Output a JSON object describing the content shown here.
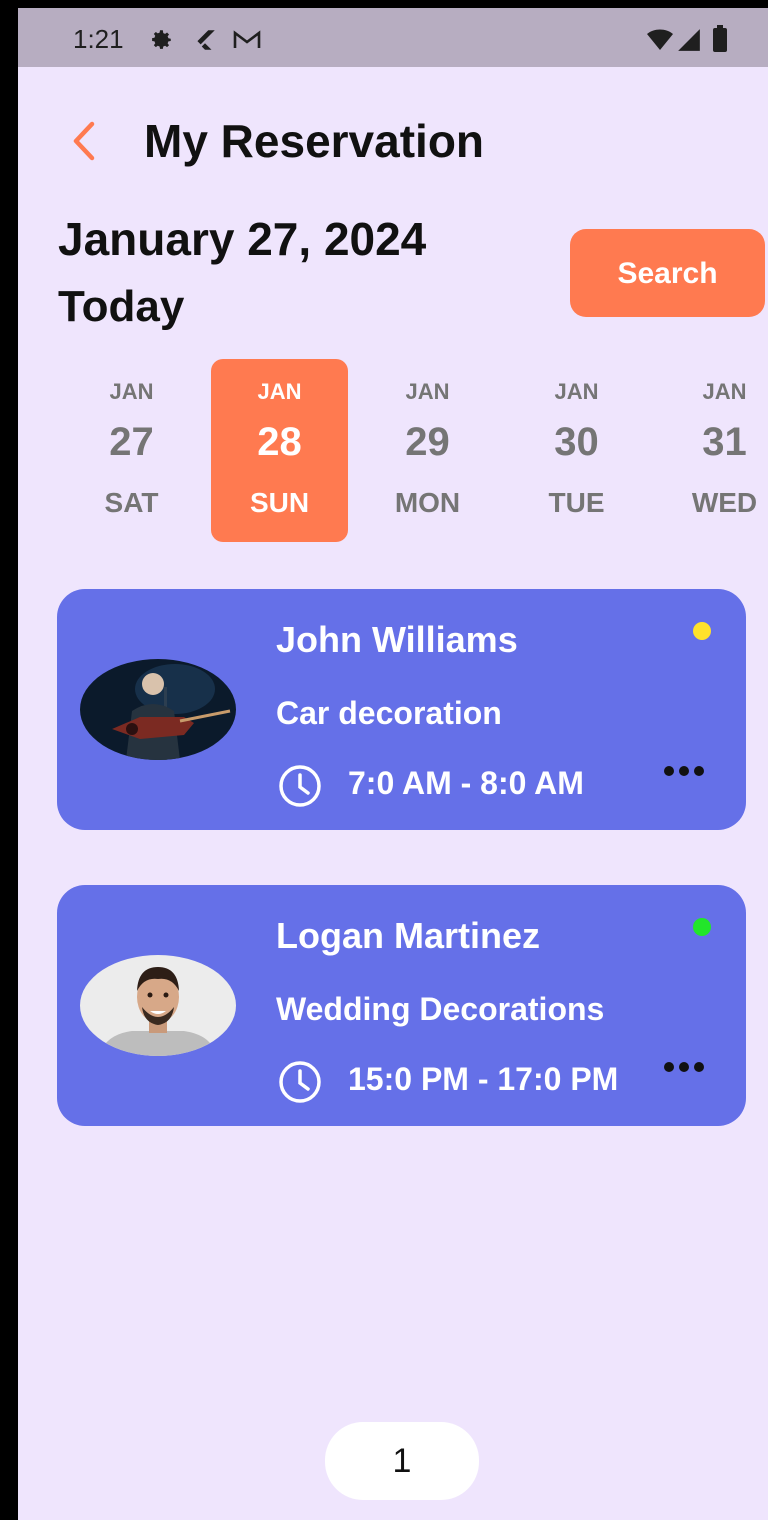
{
  "status_bar": {
    "time": "1:21",
    "icons": [
      "settings-icon",
      "flutter-icon",
      "gmail-icon",
      "wifi-icon",
      "signal-icon",
      "battery-icon"
    ]
  },
  "header": {
    "title": "My Reservation",
    "back_icon": "chevron-left-icon"
  },
  "date": {
    "title": "January 27, 2024",
    "subtitle": "Today"
  },
  "search_button": {
    "label": "Search"
  },
  "calendar": {
    "days": [
      {
        "month": "JAN",
        "day": "27",
        "weekday": "SAT",
        "selected": false
      },
      {
        "month": "JAN",
        "day": "28",
        "weekday": "SUN",
        "selected": true
      },
      {
        "month": "JAN",
        "day": "29",
        "weekday": "MON",
        "selected": false
      },
      {
        "month": "JAN",
        "day": "30",
        "weekday": "TUE",
        "selected": false
      },
      {
        "month": "JAN",
        "day": "31",
        "weekday": "WED",
        "selected": false
      }
    ]
  },
  "reservations": [
    {
      "name": "John Williams",
      "service": "Car decoration",
      "time": "7:0 AM - 8:0 AM",
      "status_color": "#ffe22b",
      "photo": "guitarist-photo"
    },
    {
      "name": "Logan Martinez",
      "service": "Wedding Decorations",
      "time": "15:0 PM - 17:0 PM",
      "status_color": "#22e62a",
      "photo": "man-portrait-photo"
    }
  ],
  "pagination": {
    "current_page": "1"
  },
  "colors": {
    "accent": "#ff7a50",
    "card": "#6570e8",
    "background": "#efe5fd"
  }
}
